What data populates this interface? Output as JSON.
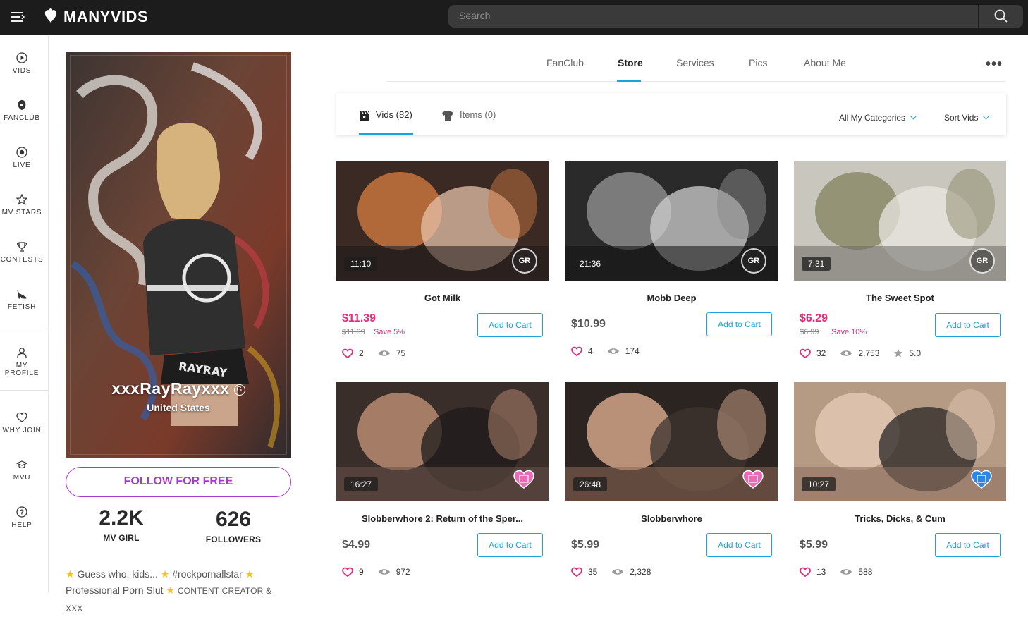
{
  "header": {
    "logo_text": "MANYVIDS",
    "search_placeholder": "Search"
  },
  "sidenav": [
    {
      "label": "VIDS",
      "icon": "play-circle-icon"
    },
    {
      "label": "FANCLUB",
      "icon": "fanclub-icon"
    },
    {
      "label": "LIVE",
      "icon": "live-icon"
    },
    {
      "label": "MV STARS",
      "icon": "star-icon"
    },
    {
      "label": "CONTESTS",
      "icon": "trophy-icon"
    },
    {
      "label": "FETISH",
      "icon": "heel-icon"
    },
    {
      "label": "MY PROFILE",
      "icon": "user-icon"
    },
    {
      "label": "WHY JOIN",
      "icon": "heart-icon"
    },
    {
      "label": "MVU",
      "icon": "graduation-cap-icon"
    },
    {
      "label": "HELP",
      "icon": "help-icon"
    }
  ],
  "profile": {
    "name": "xxxRayRayxxx",
    "badge": "G",
    "country": "United States",
    "follow_label": "FOLLOW FOR FREE",
    "stats": [
      {
        "value": "2.2K",
        "label": "MV GIRL"
      },
      {
        "value": "626",
        "label": "FOLLOWERS"
      }
    ],
    "bio": {
      "star": "★",
      "line1_a": "Guess who, kids...",
      "line1_b": "#rockpornallstar",
      "line2_a": "Professional Porn Slut",
      "line2_b": "CONTENT CREATOR & XXX"
    }
  },
  "tabs": [
    {
      "label": "FanClub"
    },
    {
      "label": "Store"
    },
    {
      "label": "Services"
    },
    {
      "label": "Pics"
    },
    {
      "label": "About Me"
    }
  ],
  "more_label": "•••",
  "filters": {
    "vids_tab": "Vids (82)",
    "items_tab": "Items (0)",
    "categories": "All My Categories",
    "sort": "Sort Vids"
  },
  "add_to_cart": "Add to Cart",
  "videos": [
    {
      "title": "Got Milk",
      "duration": "11:10",
      "price": "$11.39",
      "old_price": "$11.99",
      "save": "Save 5%",
      "likes": "2",
      "views": "75",
      "rating": null,
      "watermark": "GR",
      "colors": [
        "#3b2a24",
        "#c8743e",
        "#e6c2a8",
        "#1d1a1a"
      ]
    },
    {
      "title": "Mobb Deep",
      "duration": "21:36",
      "price": "$10.99",
      "old_price": null,
      "save": null,
      "likes": "4",
      "views": "174",
      "rating": null,
      "watermark": "GR",
      "colors": [
        "#2a2a2a",
        "#8a8a8a",
        "#cfcfcf",
        "#111111"
      ]
    },
    {
      "title": "The Sweet Spot",
      "duration": "7:31",
      "price": "$6.29",
      "old_price": "$6.99",
      "save": "Save 10%",
      "likes": "32",
      "views": "2,753",
      "rating": "5.0",
      "watermark": "GR",
      "colors": [
        "#c9c6bd",
        "#8c8a6a",
        "#e9e7e2",
        "#6c6a66"
      ]
    },
    {
      "title": "Slobberwhore 2: Return of the Sper...",
      "duration": "16:27",
      "price": "$4.99",
      "old_price": null,
      "save": null,
      "likes": "9",
      "views": "972",
      "rating": null,
      "watermark": "heart-pink",
      "colors": [
        "#3a2e2a",
        "#b88a70",
        "#1e1b1b",
        "#6a5248"
      ]
    },
    {
      "title": "Slobberwhore",
      "duration": "26:48",
      "price": "$5.99",
      "old_price": null,
      "save": null,
      "likes": "35",
      "views": "2,328",
      "rating": null,
      "watermark": "heart-pink",
      "colors": [
        "#2c2420",
        "#d2a58a",
        "#3e3430",
        "#8f6b57"
      ]
    },
    {
      "title": "Tricks, Dicks, & Cum",
      "duration": "10:27",
      "price": "$5.99",
      "old_price": null,
      "save": null,
      "likes": "13",
      "views": "588",
      "rating": null,
      "watermark": "heart-blue",
      "colors": [
        "#b59a84",
        "#e2c7b3",
        "#2a2525",
        "#8b6e5c"
      ]
    }
  ]
}
